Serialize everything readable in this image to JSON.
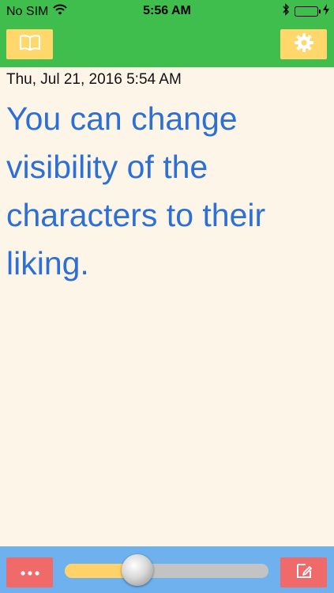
{
  "status_bar": {
    "carrier": "No SIM",
    "time": "5:56 AM",
    "icons": [
      "wifi-icon",
      "bluetooth-icon",
      "battery-icon",
      "charging-icon"
    ]
  },
  "toolbar": {
    "left_icon": "book-icon",
    "right_icon": "gear-icon"
  },
  "content": {
    "date": "Thu, Jul 21, 2016 5:54 AM",
    "message": "You can change visibility of the characters to their liking."
  },
  "bottom_bar": {
    "more_icon": "more-icon",
    "edit_icon": "edit-icon",
    "slider_value": 0.33
  },
  "colors": {
    "top_bar": "#3fbe4e",
    "top_button": "#ffd76a",
    "background": "#fdf5e8",
    "message_text": "#2c6fd6",
    "bottom_bar": "#6fb1ee",
    "bottom_button": "#f06a6a",
    "slider_fill": "#ffd26a"
  }
}
